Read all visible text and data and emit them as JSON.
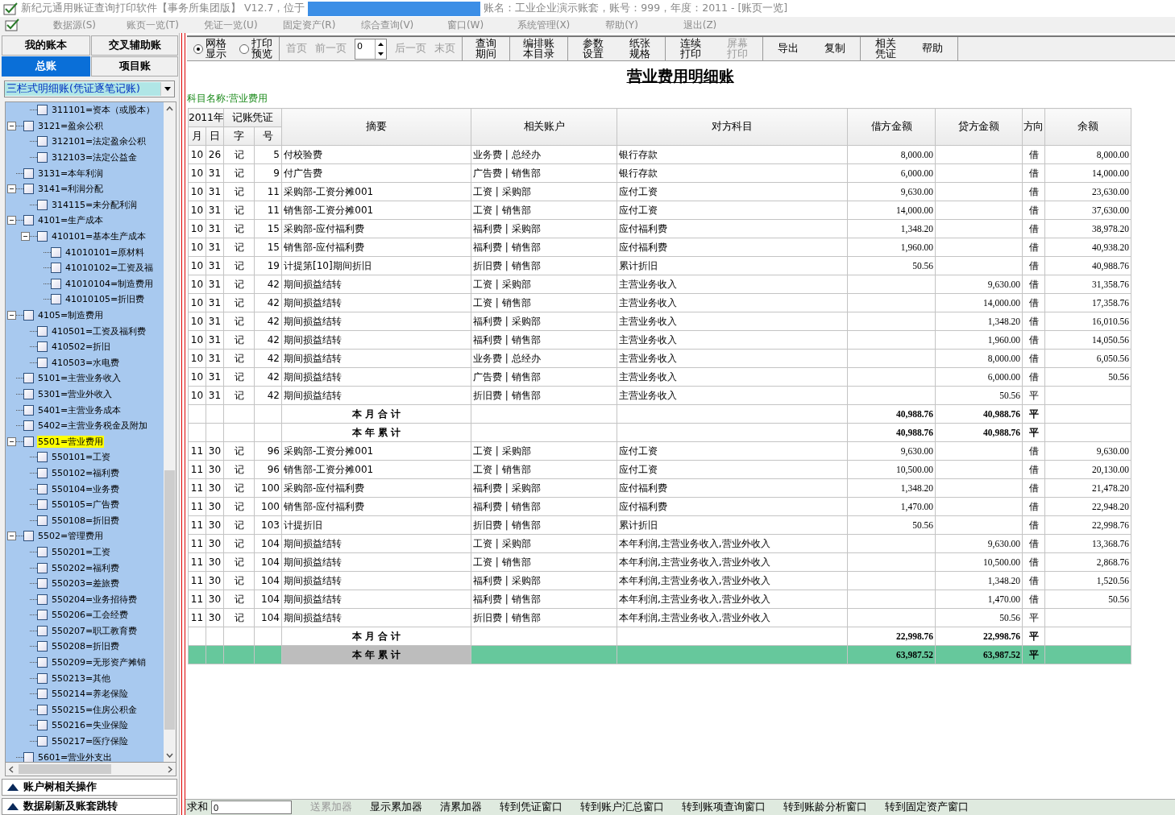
{
  "window": {
    "title_before": "新纪元通用账证查询打印软件【事务所集团版】 V12.7，位于",
    "title_after": "账名：工业企业演示账套，账号：999，年度：2011 - [账页一览]"
  },
  "menu": [
    {
      "label": "数据源(S)",
      "disabled": true
    },
    {
      "label": "账页一览(T)",
      "disabled": true
    },
    {
      "label": "凭证一览(U)",
      "disabled": true
    },
    {
      "label": "固定资产(R)",
      "disabled": true
    },
    {
      "label": "综合查询(V)",
      "disabled": true
    },
    {
      "label": "窗口(W)",
      "disabled": true
    },
    {
      "label": "系统管理(X)",
      "disabled": true
    },
    {
      "label": "帮助(Y)",
      "disabled": true
    },
    {
      "label": "退出(Z)",
      "disabled": true
    }
  ],
  "sidebar": {
    "tabs": [
      {
        "label": "我的账本",
        "selected": false
      },
      {
        "label": "交叉辅助账",
        "selected": false
      },
      {
        "label": "总账",
        "selected": true
      },
      {
        "label": "项目账",
        "selected": false
      }
    ],
    "book_type": "三栏式明细账(凭证逐笔记账)",
    "tree": [
      {
        "children": [
          {
            "label": "311101=资本（或股本）",
            "checked": false,
            "selected": false
          }
        ]
      },
      {
        "label": "3121=盈余公积",
        "checked": false,
        "selected": false,
        "expanded": true,
        "children": [
          {
            "label": "312101=法定盈余公积",
            "checked": false,
            "selected": false
          },
          {
            "label": "312103=法定公益金",
            "checked": false,
            "selected": false
          }
        ]
      },
      {
        "label": "3131=本年利润",
        "checked": false,
        "selected": false
      },
      {
        "label": "3141=利润分配",
        "checked": false,
        "selected": false,
        "expanded": true,
        "children": [
          {
            "label": "314115=未分配利润",
            "checked": false,
            "selected": false
          }
        ]
      },
      {
        "label": "4101=生产成本",
        "checked": false,
        "selected": false,
        "expanded": true,
        "children": [
          {
            "label": "410101=基本生产成本",
            "checked": false,
            "selected": false,
            "expanded": true,
            "children": [
              {
                "label": "41010101=原材料",
                "checked": false,
                "selected": false
              },
              {
                "label": "41010102=工资及福",
                "checked": false,
                "selected": false
              },
              {
                "label": "41010104=制造费用",
                "checked": false,
                "selected": false
              },
              {
                "label": "41010105=折旧费",
                "checked": false,
                "selected": false
              }
            ]
          }
        ]
      },
      {
        "label": "4105=制造费用",
        "checked": false,
        "selected": false,
        "expanded": true,
        "children": [
          {
            "label": "410501=工资及福利费",
            "checked": false,
            "selected": false
          },
          {
            "label": "410502=折旧",
            "checked": false,
            "selected": false
          },
          {
            "label": "410503=水电费",
            "checked": false,
            "selected": false
          }
        ]
      },
      {
        "label": "5101=主营业务收入",
        "checked": false,
        "selected": false
      },
      {
        "label": "5301=营业外收入",
        "checked": false,
        "selected": false
      },
      {
        "label": "5401=主营业务成本",
        "checked": false,
        "selected": false
      },
      {
        "label": "5402=主营业务税金及附加",
        "checked": false,
        "selected": false
      },
      {
        "label": "5501=营业费用",
        "checked": false,
        "selected": true,
        "expanded": true,
        "children": [
          {
            "label": "550101=工资",
            "checked": false,
            "selected": false
          },
          {
            "label": "550102=福利费",
            "checked": false,
            "selected": false
          },
          {
            "label": "550104=业务费",
            "checked": false,
            "selected": false
          },
          {
            "label": "550105=广告费",
            "checked": false,
            "selected": false
          },
          {
            "label": "550108=折旧费",
            "checked": false,
            "selected": false
          }
        ]
      },
      {
        "label": "5502=管理费用",
        "checked": false,
        "selected": false,
        "expanded": true,
        "children": [
          {
            "label": "550201=工资",
            "checked": false,
            "selected": false
          },
          {
            "label": "550202=福利费",
            "checked": false,
            "selected": false
          },
          {
            "label": "550203=差旅费",
            "checked": false,
            "selected": false
          },
          {
            "label": "550204=业务招待费",
            "checked": false,
            "selected": false
          },
          {
            "label": "550206=工会经费",
            "checked": false,
            "selected": false
          },
          {
            "label": "550207=职工教育费",
            "checked": false,
            "selected": false
          },
          {
            "label": "550208=折旧费",
            "checked": false,
            "selected": false
          },
          {
            "label": "550209=无形资产摊销",
            "checked": false,
            "selected": false
          },
          {
            "label": "550213=其他",
            "checked": false,
            "selected": false
          },
          {
            "label": "550214=养老保险",
            "checked": false,
            "selected": false
          },
          {
            "label": "550215=住房公积金",
            "checked": false,
            "selected": false
          },
          {
            "label": "550216=失业保险",
            "checked": false,
            "selected": false
          },
          {
            "label": "550217=医疗保险",
            "checked": false,
            "selected": false
          }
        ]
      },
      {
        "label": "5601=营业外支出",
        "checked": false,
        "selected": false
      }
    ],
    "sections": [
      "账户树相关操作",
      "数据刷新及账套跳转"
    ]
  },
  "toolbar": {
    "view_modes": [
      {
        "label": "网格显示",
        "selected": true
      },
      {
        "label": "打印预览",
        "selected": false
      }
    ],
    "nav_before": [
      {
        "label": "首页",
        "disabled": true
      },
      {
        "label": "前一页",
        "disabled": true
      }
    ],
    "page_value": "0",
    "nav_after": [
      {
        "label": "后一页",
        "disabled": true
      },
      {
        "label": "末页",
        "disabled": true
      }
    ],
    "button_groups": [
      {
        "buttons": [
          {
            "label": "查询期间",
            "disabled": false
          }
        ]
      },
      {
        "buttons": [
          {
            "label": "编排账本目录",
            "disabled": false
          }
        ]
      },
      {
        "buttons": [
          {
            "label": "参数设置",
            "disabled": false
          },
          {
            "label": "纸张规格",
            "disabled": false
          }
        ]
      },
      {
        "buttons": [
          {
            "label": "连续打印",
            "disabled": false
          },
          {
            "label": "屏幕打印",
            "disabled": true
          }
        ]
      },
      {
        "buttons": [
          {
            "label": "导出",
            "disabled": false
          },
          {
            "label": "复制",
            "disabled": false
          }
        ]
      },
      {
        "buttons": [
          {
            "label": "相关凭证",
            "disabled": false
          },
          {
            "label": "帮助",
            "disabled": false
          }
        ]
      }
    ]
  },
  "ledger": {
    "title": "营业费用明细账",
    "subject": "科目名称:营业费用",
    "header": {
      "year": "2011年",
      "voucher": "记账凭证",
      "month": "月",
      "day": "日",
      "voucher_type": "字",
      "voucher_no": "号",
      "summary": "摘要",
      "account": "相关账户",
      "counter_account": "对方科目",
      "debit": "借方金额",
      "credit": "贷方金额",
      "direction": "方向",
      "balance": "余额"
    },
    "rows": [
      {
        "kind": "entry",
        "selected": false,
        "month": "10",
        "day": "26",
        "voucher_type": "记",
        "voucher_no": "5",
        "summary": "付校验费",
        "account": "业务费 | 总经办",
        "counter_account": "银行存款",
        "debit": "8,000.00",
        "direction": "借",
        "balance": "8,000.00"
      },
      {
        "kind": "entry",
        "selected": false,
        "month": "10",
        "day": "31",
        "voucher_type": "记",
        "voucher_no": "9",
        "summary": "付广告费",
        "account": "广告费 | 销售部",
        "counter_account": "银行存款",
        "debit": "6,000.00",
        "direction": "借",
        "balance": "14,000.00"
      },
      {
        "kind": "entry",
        "selected": false,
        "month": "10",
        "day": "31",
        "voucher_type": "记",
        "voucher_no": "11",
        "summary": "采购部-工资分摊001",
        "account": "工资 | 采购部",
        "counter_account": "应付工资",
        "debit": "9,630.00",
        "direction": "借",
        "balance": "23,630.00"
      },
      {
        "kind": "entry",
        "selected": false,
        "month": "10",
        "day": "31",
        "voucher_type": "记",
        "voucher_no": "11",
        "summary": "销售部-工资分摊001",
        "account": "工资 | 销售部",
        "counter_account": "应付工资",
        "debit": "14,000.00",
        "direction": "借",
        "balance": "37,630.00"
      },
      {
        "kind": "entry",
        "selected": false,
        "month": "10",
        "day": "31",
        "voucher_type": "记",
        "voucher_no": "15",
        "summary": "采购部-应付福利费",
        "account": "福利费 | 采购部",
        "counter_account": "应付福利费",
        "debit": "1,348.20",
        "direction": "借",
        "balance": "38,978.20"
      },
      {
        "kind": "entry",
        "selected": false,
        "month": "10",
        "day": "31",
        "voucher_type": "记",
        "voucher_no": "15",
        "summary": "销售部-应付福利费",
        "account": "福利费 | 销售部",
        "counter_account": "应付福利费",
        "debit": "1,960.00",
        "direction": "借",
        "balance": "40,938.20"
      },
      {
        "kind": "entry",
        "selected": false,
        "month": "10",
        "day": "31",
        "voucher_type": "记",
        "voucher_no": "19",
        "summary": "计提第[10]期间折旧",
        "account": "折旧费 | 销售部",
        "counter_account": "累计折旧",
        "debit": "50.56",
        "direction": "借",
        "balance": "40,988.76"
      },
      {
        "kind": "entry",
        "selected": false,
        "month": "10",
        "day": "31",
        "voucher_type": "记",
        "voucher_no": "42",
        "summary": "期间损益结转",
        "account": "工资 | 采购部",
        "counter_account": "主营业务收入",
        "credit": "9,630.00",
        "direction": "借",
        "balance": "31,358.76"
      },
      {
        "kind": "entry",
        "selected": false,
        "month": "10",
        "day": "31",
        "voucher_type": "记",
        "voucher_no": "42",
        "summary": "期间损益结转",
        "account": "工资 | 销售部",
        "counter_account": "主营业务收入",
        "credit": "14,000.00",
        "direction": "借",
        "balance": "17,358.76"
      },
      {
        "kind": "entry",
        "selected": false,
        "month": "10",
        "day": "31",
        "voucher_type": "记",
        "voucher_no": "42",
        "summary": "期间损益结转",
        "account": "福利费 | 采购部",
        "counter_account": "主营业务收入",
        "credit": "1,348.20",
        "direction": "借",
        "balance": "16,010.56"
      },
      {
        "kind": "entry",
        "selected": false,
        "month": "10",
        "day": "31",
        "voucher_type": "记",
        "voucher_no": "42",
        "summary": "期间损益结转",
        "account": "福利费 | 销售部",
        "counter_account": "主营业务收入",
        "credit": "1,960.00",
        "direction": "借",
        "balance": "14,050.56"
      },
      {
        "kind": "entry",
        "selected": false,
        "month": "10",
        "day": "31",
        "voucher_type": "记",
        "voucher_no": "42",
        "summary": "期间损益结转",
        "account": "业务费 | 总经办",
        "counter_account": "主营业务收入",
        "credit": "8,000.00",
        "direction": "借",
        "balance": "6,050.56"
      },
      {
        "kind": "entry",
        "selected": false,
        "month": "10",
        "day": "31",
        "voucher_type": "记",
        "voucher_no": "42",
        "summary": "期间损益结转",
        "account": "广告费 | 销售部",
        "counter_account": "主营业务收入",
        "credit": "6,000.00",
        "direction": "借",
        "balance": "50.56"
      },
      {
        "kind": "entry",
        "selected": false,
        "month": "10",
        "day": "31",
        "voucher_type": "记",
        "voucher_no": "42",
        "summary": "期间损益结转",
        "account": "折旧费 | 销售部",
        "counter_account": "主营业务收入",
        "credit": "50.56",
        "direction": "平"
      },
      {
        "kind": "total",
        "selected": false,
        "summary": "本 月 合 计",
        "debit": "40,988.76",
        "credit": "40,988.76",
        "direction": "平"
      },
      {
        "kind": "total",
        "selected": false,
        "summary": "本 年 累 计",
        "debit": "40,988.76",
        "credit": "40,988.76",
        "direction": "平"
      },
      {
        "kind": "entry",
        "selected": false,
        "month": "11",
        "day": "30",
        "voucher_type": "记",
        "voucher_no": "96",
        "summary": "采购部-工资分摊001",
        "account": "工资 | 采购部",
        "counter_account": "应付工资",
        "debit": "9,630.00",
        "direction": "借",
        "balance": "9,630.00"
      },
      {
        "kind": "entry",
        "selected": false,
        "month": "11",
        "day": "30",
        "voucher_type": "记",
        "voucher_no": "96",
        "summary": "销售部-工资分摊001",
        "account": "工资 | 销售部",
        "counter_account": "应付工资",
        "debit": "10,500.00",
        "direction": "借",
        "balance": "20,130.00"
      },
      {
        "kind": "entry",
        "selected": false,
        "month": "11",
        "day": "30",
        "voucher_type": "记",
        "voucher_no": "100",
        "summary": "采购部-应付福利费",
        "account": "福利费 | 采购部",
        "counter_account": "应付福利费",
        "debit": "1,348.20",
        "direction": "借",
        "balance": "21,478.20"
      },
      {
        "kind": "entry",
        "selected": false,
        "month": "11",
        "day": "30",
        "voucher_type": "记",
        "voucher_no": "100",
        "summary": "销售部-应付福利费",
        "account": "福利费 | 销售部",
        "counter_account": "应付福利费",
        "debit": "1,470.00",
        "direction": "借",
        "balance": "22,948.20"
      },
      {
        "kind": "entry",
        "selected": false,
        "month": "11",
        "day": "30",
        "voucher_type": "记",
        "voucher_no": "103",
        "summary": "计提折旧",
        "account": "折旧费 | 销售部",
        "counter_account": "累计折旧",
        "debit": "50.56",
        "direction": "借",
        "balance": "22,998.76"
      },
      {
        "kind": "entry",
        "selected": false,
        "month": "11",
        "day": "30",
        "voucher_type": "记",
        "voucher_no": "104",
        "summary": "期间损益结转",
        "account": "工资 | 采购部",
        "counter_account": "本年利润,主营业务收入,营业外收入",
        "credit": "9,630.00",
        "direction": "借",
        "balance": "13,368.76"
      },
      {
        "kind": "entry",
        "selected": false,
        "month": "11",
        "day": "30",
        "voucher_type": "记",
        "voucher_no": "104",
        "summary": "期间损益结转",
        "account": "工资 | 销售部",
        "counter_account": "本年利润,主营业务收入,营业外收入",
        "credit": "10,500.00",
        "direction": "借",
        "balance": "2,868.76"
      },
      {
        "kind": "entry",
        "selected": false,
        "month": "11",
        "day": "30",
        "voucher_type": "记",
        "voucher_no": "104",
        "summary": "期间损益结转",
        "account": "福利费 | 采购部",
        "counter_account": "本年利润,主营业务收入,营业外收入",
        "credit": "1,348.20",
        "direction": "借",
        "balance": "1,520.56"
      },
      {
        "kind": "entry",
        "selected": false,
        "month": "11",
        "day": "30",
        "voucher_type": "记",
        "voucher_no": "104",
        "summary": "期间损益结转",
        "account": "福利费 | 销售部",
        "counter_account": "本年利润,主营业务收入,营业外收入",
        "credit": "1,470.00",
        "direction": "借",
        "balance": "50.56"
      },
      {
        "kind": "entry",
        "selected": false,
        "month": "11",
        "day": "30",
        "voucher_type": "记",
        "voucher_no": "104",
        "summary": "期间损益结转",
        "account": "折旧费 | 销售部",
        "counter_account": "本年利润,主营业务收入,营业外收入",
        "credit": "50.56",
        "direction": "平"
      },
      {
        "kind": "total",
        "selected": false,
        "summary": "本 月 合 计",
        "debit": "22,998.76",
        "credit": "22,998.76",
        "direction": "平"
      },
      {
        "kind": "total",
        "selected": true,
        "summary": "本 年 累 计",
        "debit": "63,987.52",
        "credit": "63,987.52",
        "direction": "平"
      }
    ]
  },
  "status_bar": {
    "sum_label": "求和",
    "sum_value": "0",
    "buttons": [
      {
        "label": "送累加器",
        "disabled": true
      },
      {
        "label": "显示累加器",
        "disabled": false
      },
      {
        "label": "清累加器",
        "disabled": false
      },
      {
        "label": "转到凭证窗口",
        "disabled": false
      },
      {
        "label": "转到账户汇总窗口",
        "disabled": false
      },
      {
        "label": "转到账项查询窗口",
        "disabled": false
      },
      {
        "label": "转到账龄分析窗口",
        "disabled": false
      },
      {
        "label": "转到固定资产窗口",
        "disabled": false
      }
    ]
  }
}
